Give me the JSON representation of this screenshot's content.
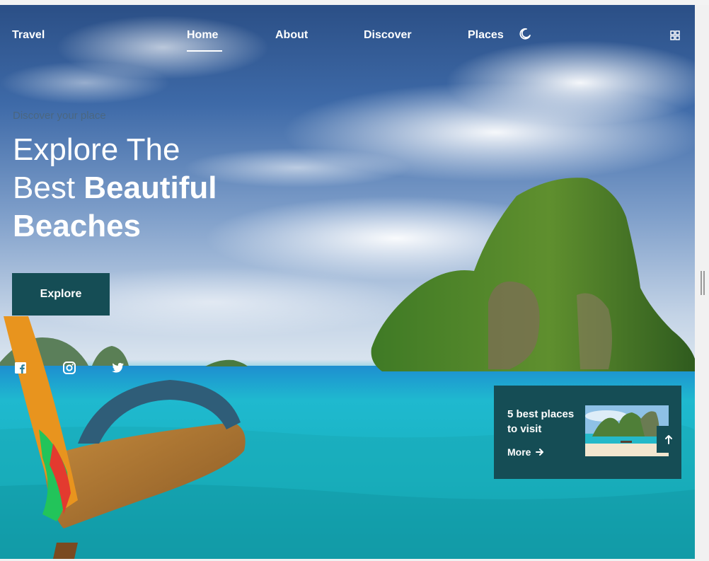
{
  "nav": {
    "logo": "Travel",
    "links": [
      "Home",
      "About",
      "Discover",
      "Places"
    ],
    "active": "Home",
    "theme_icon": "moon-icon",
    "menu_icon": "grid-icon"
  },
  "hero": {
    "subtitle": "Discover your place",
    "title_line1": "Explore The",
    "title_line2_light": "Best ",
    "title_line2_bold": "Beautiful",
    "title_line3": "Beaches",
    "button": "Explore"
  },
  "social": [
    "facebook-icon",
    "instagram-icon",
    "twitter-icon"
  ],
  "card": {
    "title": "5 best places to visit",
    "more": "More"
  },
  "colors": {
    "accent": "#154d55",
    "text": "#ffffff"
  }
}
